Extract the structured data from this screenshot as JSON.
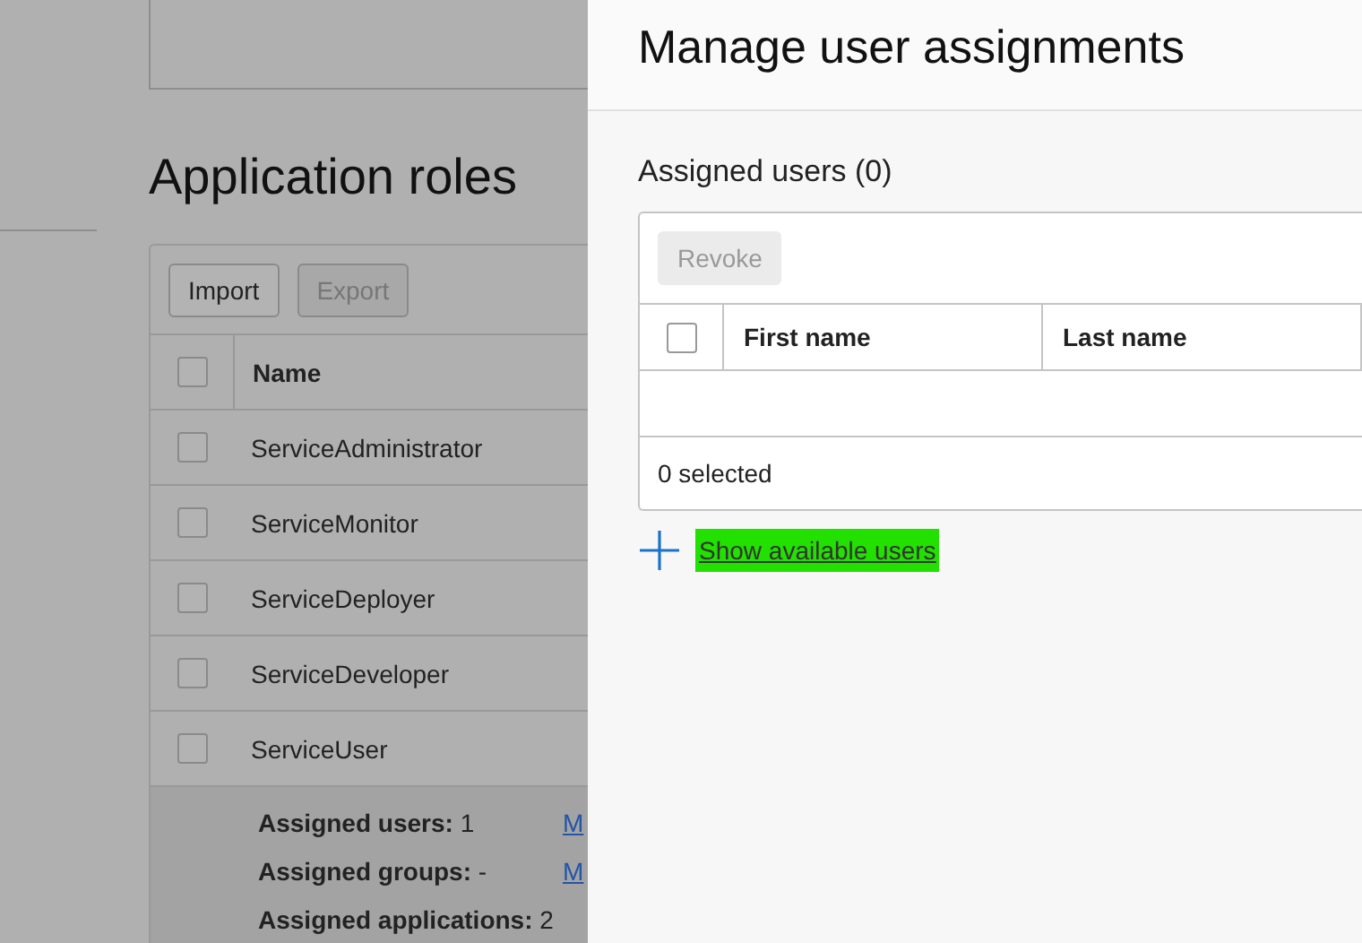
{
  "background_page": {
    "heading": "Application roles",
    "toolbar": [
      {
        "label": "Import",
        "disabled": false
      },
      {
        "label": "Export",
        "disabled": true
      }
    ],
    "table": {
      "header_checked": false,
      "columns": [
        "Name"
      ],
      "rows": [
        {
          "name": "ServiceAdministrator",
          "checked": false
        },
        {
          "name": "ServiceMonitor",
          "checked": false
        },
        {
          "name": "ServiceDeployer",
          "checked": false
        },
        {
          "name": "ServiceDeveloper",
          "checked": false
        },
        {
          "name": "ServiceUser",
          "checked": false
        }
      ]
    },
    "details": [
      {
        "text": "**Assigned users:** 1",
        "link": "M"
      },
      {
        "text": "**Assigned groups:** -",
        "link": "M"
      },
      {
        "text": "**Assigned applications:** 2"
      }
    ]
  },
  "panel": {
    "title": "Manage user assignments",
    "section_title": "Assigned users (0)",
    "revoke": {
      "label": "Revoke",
      "disabled": true
    },
    "header_checked": false,
    "columns": [
      "First name",
      "Last name"
    ],
    "footer": "0 selected",
    "add_link": "Show available users"
  }
}
